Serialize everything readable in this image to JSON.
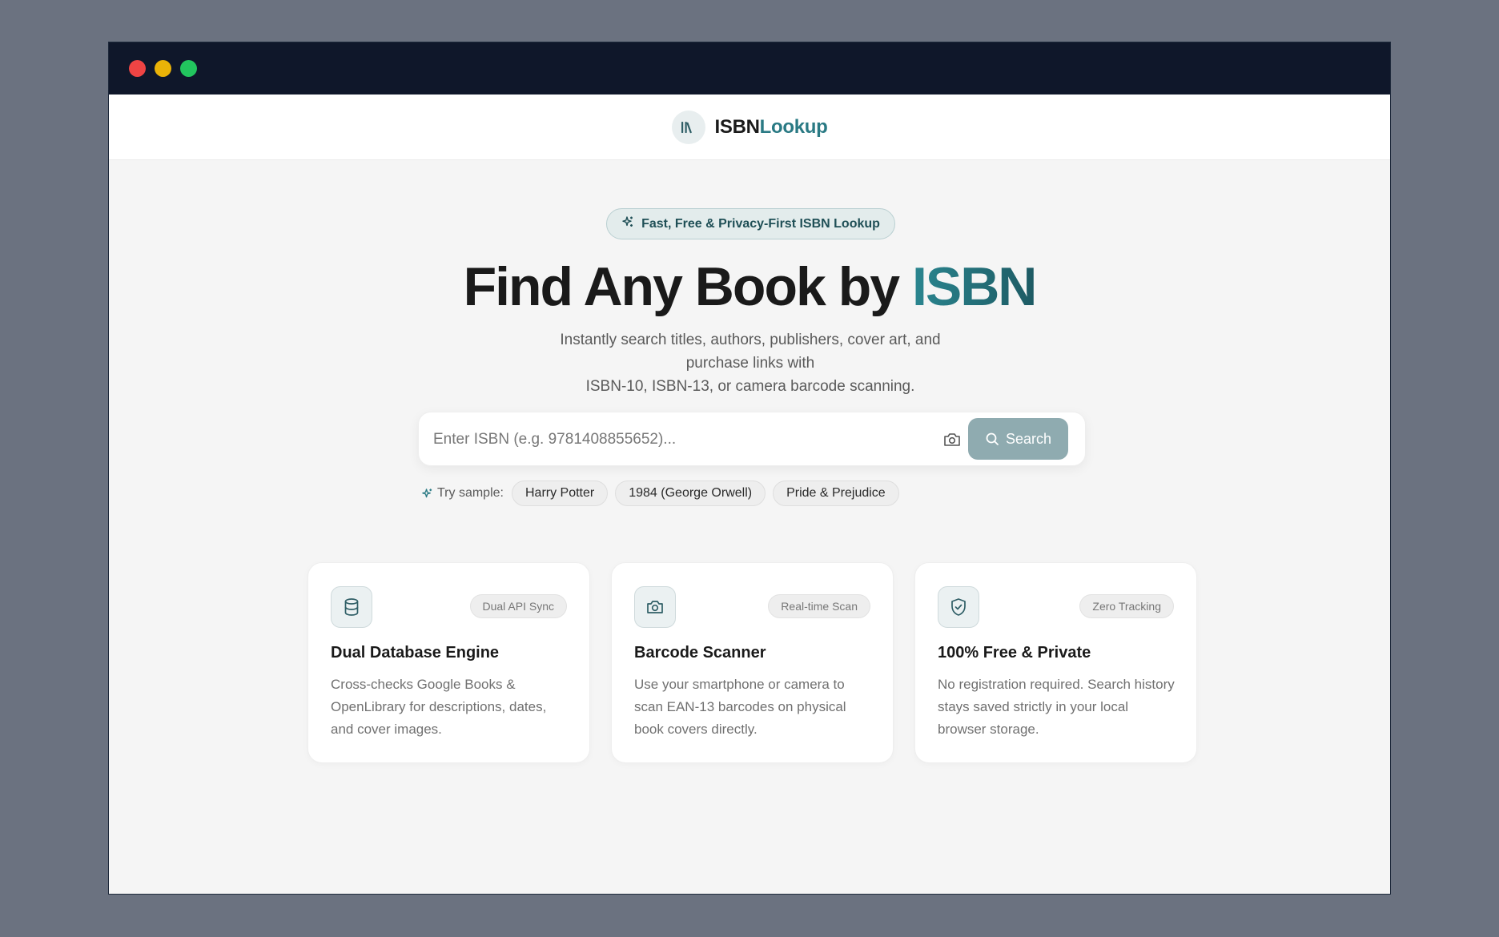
{
  "brand": {
    "part1": "ISBN",
    "part2": "Lookup",
    "icon": "library-books-icon"
  },
  "badge": {
    "text": "Fast, Free & Privacy-First ISBN Lookup",
    "icon": "sparkles-icon"
  },
  "hero": {
    "title_prefix": "Find Any Book by ",
    "title_accent": "ISBN",
    "subtitle_line1": "Instantly search titles, authors, publishers, cover art, and purchase links with",
    "subtitle_line2": "ISBN-10, ISBN-13, or camera barcode scanning."
  },
  "search": {
    "placeholder": "Enter ISBN (e.g. 9781408855652)...",
    "value": "",
    "button_label": "Search",
    "camera_icon": "camera-icon",
    "search_icon": "search-icon"
  },
  "samples": {
    "label": "Try sample:",
    "items": [
      "Harry Potter",
      "1984 (George Orwell)",
      "Pride & Prejudice"
    ]
  },
  "features": [
    {
      "icon": "database-icon",
      "tag": "Dual API Sync",
      "title": "Dual Database Engine",
      "desc": "Cross-checks Google Books & OpenLibrary for descriptions, dates, and cover images."
    },
    {
      "icon": "camera-icon",
      "tag": "Real-time Scan",
      "title": "Barcode Scanner",
      "desc": "Use your smartphone or camera to scan EAN-13 barcodes on physical book covers directly."
    },
    {
      "icon": "shield-check-icon",
      "tag": "Zero Tracking",
      "title": "100% Free & Private",
      "desc": "No registration required. Search history stays saved strictly in your local browser storage."
    }
  ],
  "colors": {
    "accent": "#2a7a84",
    "titlebar": "#0f172a",
    "search_button": "#8fabb0",
    "close": "#ef4444",
    "minimize": "#eab308",
    "maximize": "#22c55e"
  }
}
